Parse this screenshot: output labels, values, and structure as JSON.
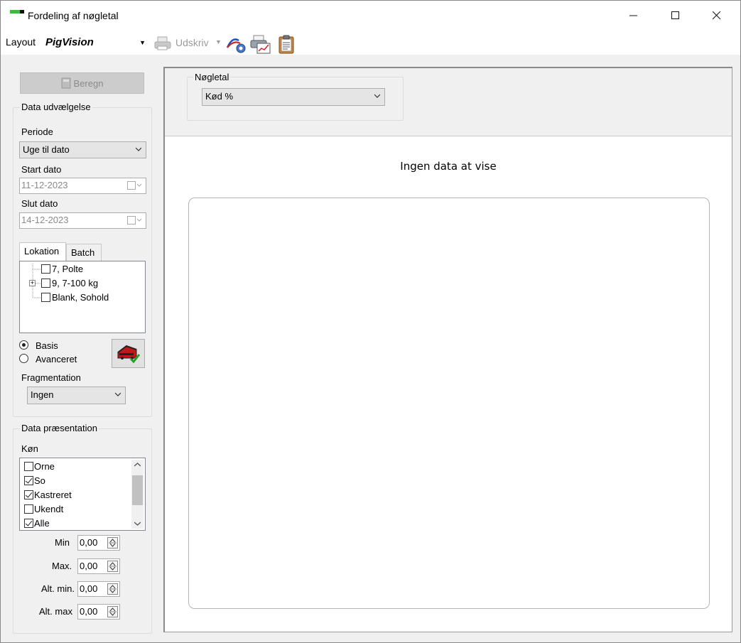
{
  "window": {
    "title": "Fordeling af nøgletal",
    "minimize_glyph": "—",
    "maximize_glyph": "☐",
    "close_glyph": "✕"
  },
  "toolbar": {
    "layout_label": "Layout",
    "layout_value": "PigVision",
    "print_label": "Udskriv",
    "icons": [
      "print-icon",
      "chart-settings-icon",
      "print-preview-chart-icon",
      "clipboard-icon"
    ]
  },
  "left_panel": {
    "calculate_button": "Beregn",
    "data_selection": {
      "title": "Data udvælgelse",
      "period_label": "Periode",
      "period_value": "Uge til dato",
      "start_label": "Start dato",
      "start_value": "11-12-2023",
      "end_label": "Slut dato",
      "end_value": "14-12-2023",
      "tabs": [
        "Lokation",
        "Batch"
      ],
      "tree_items": [
        {
          "label": "7, Polte",
          "expandable": false,
          "checked": false
        },
        {
          "label": "9, 7-100 kg",
          "expandable": true,
          "checked": false
        },
        {
          "label": "Blank, Sohold",
          "expandable": false,
          "checked": false
        }
      ],
      "radio_basis": "Basis",
      "radio_advanced": "Avanceret",
      "radio_selected": "Basis",
      "fragmentation_label": "Fragmentation",
      "fragmentation_value": "Ingen"
    },
    "data_presentation": {
      "title": "Data præsentation",
      "gender_label": "Køn",
      "gender_items": [
        {
          "label": "Orne",
          "checked": false
        },
        {
          "label": "So",
          "checked": true
        },
        {
          "label": "Kastreret",
          "checked": true
        },
        {
          "label": "Ukendt",
          "checked": false
        },
        {
          "label": "Alle",
          "checked": true
        }
      ],
      "min_label": "Min",
      "min_value": "0,00",
      "max_label": "Max.",
      "max_value": "0,00",
      "alt_min_label": "Alt. min.",
      "alt_min_value": "0,00",
      "alt_max_label": "Alt. max",
      "alt_max_value": "0,00"
    }
  },
  "main": {
    "kpi_group_title": "Nøgletal",
    "kpi_value": "Kød %",
    "no_data_text": "Ingen data at vise"
  }
}
